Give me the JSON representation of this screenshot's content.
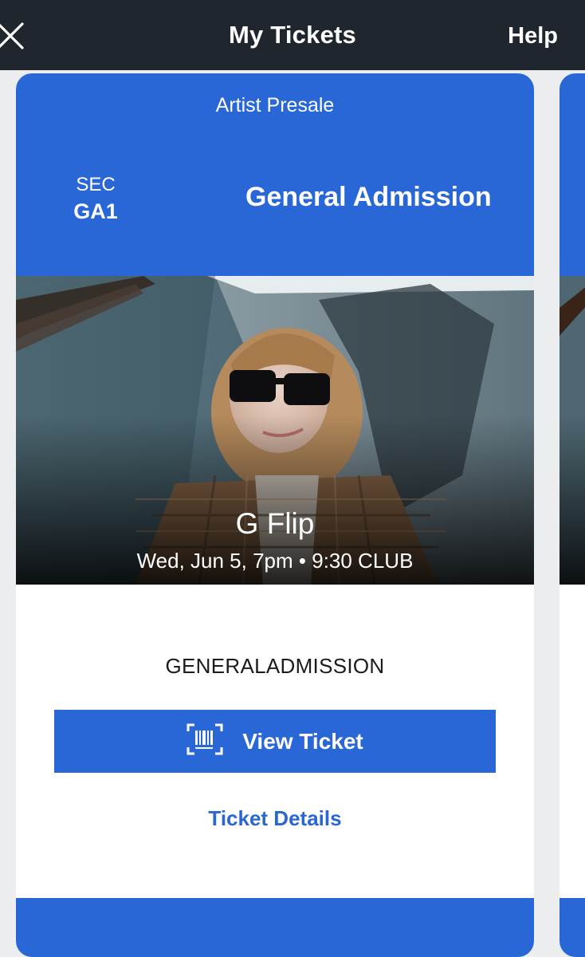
{
  "header": {
    "title": "My Tickets",
    "help_label": "Help",
    "close_icon": "close-icon"
  },
  "ticket": {
    "presale_label": "Artist Presale",
    "section_label": "SEC",
    "section_value": "GA1",
    "admission": "General Admission",
    "artist": "G Flip",
    "date_time": "Wed, Jun 5, 7pm",
    "separator": "•",
    "venue": "9:30 CLUB",
    "ticket_type": "GENERALADMISSION",
    "view_ticket_label": "View Ticket",
    "view_ticket_icon": "barcode-icon",
    "details_label": "Ticket Details"
  },
  "colors": {
    "brand_blue": "#2a67d6",
    "top_bar": "#1f262d"
  }
}
